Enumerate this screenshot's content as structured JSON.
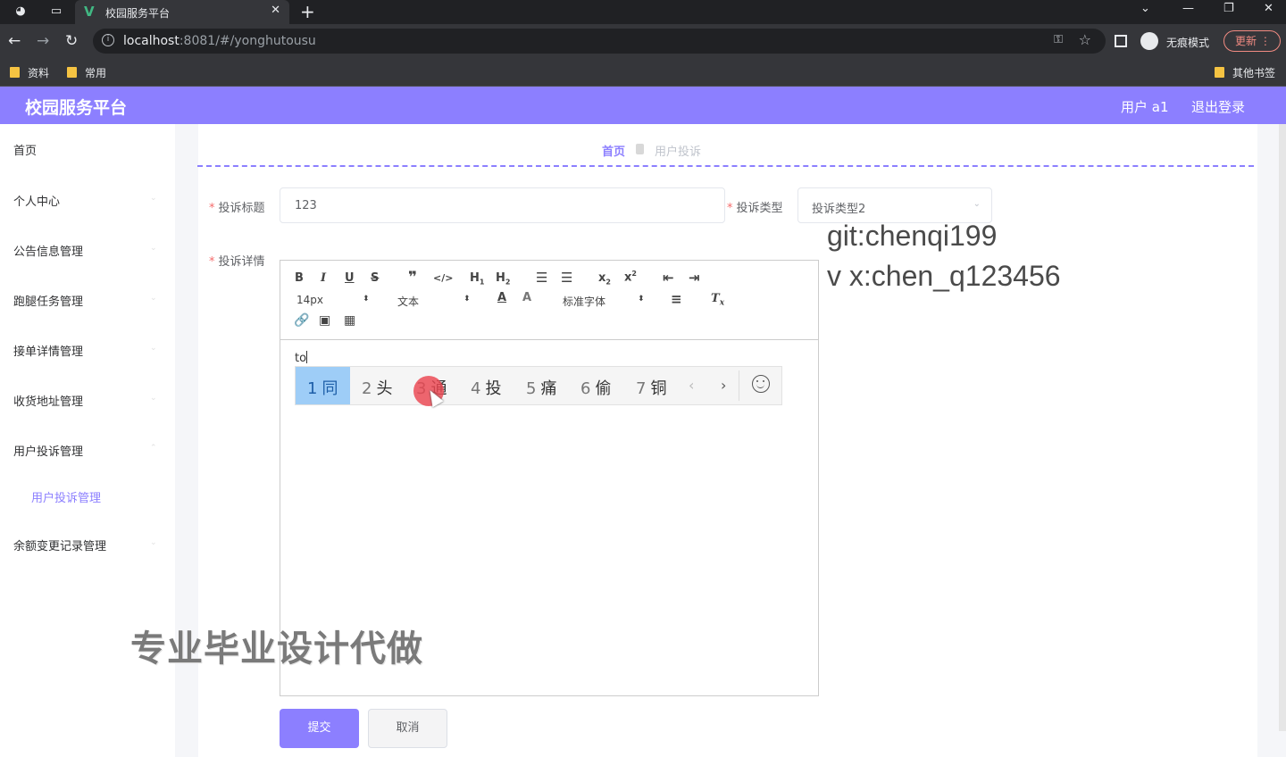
{
  "browser": {
    "tab_title": "校园服务平台",
    "url_host": "localhost",
    "url_rest": ":8081/#/yonghutousu",
    "incognito_label": "无痕模式",
    "update_label": "更新",
    "bookmarks": [
      "资料",
      "常用"
    ],
    "other_bookmarks": "其他书签"
  },
  "app": {
    "brand": "校园服务平台",
    "user": "用户 a1",
    "logout": "退出登录"
  },
  "sidebar": {
    "items": [
      "首页",
      "个人中心",
      "公告信息管理",
      "跑腿任务管理",
      "接单详情管理",
      "收货地址管理",
      "用户投诉管理",
      "余额变更记录管理"
    ],
    "sub_item": "用户投诉管理"
  },
  "breadcrumb": {
    "home": "首页",
    "current": "用户投诉"
  },
  "form": {
    "title_label": "投诉标题",
    "title_value": "123",
    "type_label": "投诉类型",
    "type_value": "投诉类型2",
    "detail_label": "投诉详情",
    "submit": "提交",
    "cancel": "取消"
  },
  "editor": {
    "font_size": "14px",
    "header_style": "文本",
    "font_family": "标准字体",
    "content": "to"
  },
  "ime": {
    "candidates": [
      {
        "num": "1",
        "char": "同"
      },
      {
        "num": "2",
        "char": "头"
      },
      {
        "num": "3",
        "char": "通"
      },
      {
        "num": "4",
        "char": "投"
      },
      {
        "num": "5",
        "char": "痛"
      },
      {
        "num": "6",
        "char": "偷"
      },
      {
        "num": "7",
        "char": "铜"
      }
    ]
  },
  "overlay": {
    "git": "git:chenqi199",
    "vx": "v x:chen_q123456",
    "watermark": "专业毕业设计代做"
  }
}
